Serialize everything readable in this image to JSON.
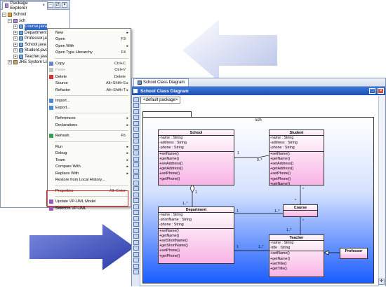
{
  "explorer": {
    "tab_label": "Package Explorer",
    "close_glyph": "×",
    "tree": [
      {
        "label": "School",
        "level": 0,
        "icon": "project-icon",
        "expanded": true
      },
      {
        "label": "sch",
        "level": 1,
        "icon": "package-icon",
        "expanded": true
      },
      {
        "label": "Course.java",
        "level": 2,
        "icon": "java-file-icon",
        "selected": true
      },
      {
        "label": "Department.java",
        "level": 2,
        "icon": "java-file-icon"
      },
      {
        "label": "Professor.java",
        "level": 2,
        "icon": "java-file-icon"
      },
      {
        "label": "School.java",
        "level": 2,
        "icon": "java-file-icon"
      },
      {
        "label": "Student.java",
        "level": 2,
        "icon": "java-file-icon"
      },
      {
        "label": "Teacher.java",
        "level": 2,
        "icon": "java-file-icon"
      },
      {
        "label": "JRE System Library",
        "level": 1,
        "icon": "library-icon"
      }
    ]
  },
  "context_menu": {
    "groups": [
      [
        {
          "label": "New",
          "submenu": true
        },
        {
          "label": "Open",
          "shortcut": "F3"
        },
        {
          "label": "Open With",
          "submenu": true
        },
        {
          "label": "Open Type Hierarchy",
          "shortcut": "F4"
        }
      ],
      [
        {
          "label": "Copy",
          "shortcut": "Ctrl+C",
          "icon": "copy-icon"
        },
        {
          "label": "Paste",
          "shortcut": "Ctrl+V",
          "disabled": true,
          "icon": "paste-icon"
        },
        {
          "label": "Delete",
          "shortcut": "Delete",
          "icon": "delete-icon"
        },
        {
          "label": "Source",
          "shortcut": "Alt+Shift+S",
          "submenu": true
        },
        {
          "label": "Refactor",
          "shortcut": "Alt+Shift+T",
          "submenu": true
        }
      ],
      [
        {
          "label": "Import...",
          "icon": "import-icon"
        },
        {
          "label": "Export...",
          "icon": "export-icon"
        }
      ],
      [
        {
          "label": "References",
          "submenu": true
        },
        {
          "label": "Declarations",
          "submenu": true
        }
      ],
      [
        {
          "label": "Refresh",
          "shortcut": "F5",
          "icon": "refresh-icon"
        }
      ],
      [
        {
          "label": "Run",
          "submenu": true
        },
        {
          "label": "Debug",
          "submenu": true
        },
        {
          "label": "Team",
          "submenu": true
        },
        {
          "label": "Compare With",
          "submenu": true
        },
        {
          "label": "Replace With",
          "submenu": true
        },
        {
          "label": "Restore from Local History..."
        }
      ],
      [
        {
          "label": "Properties",
          "shortcut": "Alt+Enter"
        }
      ],
      [
        {
          "label": "Update VP-UML Model",
          "icon": "vp-uml-icon"
        },
        {
          "label": "Select in VP-UML",
          "icon": "vp-uml-icon"
        }
      ]
    ],
    "submenu_glyph": "▸"
  },
  "diagram_window": {
    "tab_label": "School Class Diagram",
    "title": "School Class Diagram",
    "breadcrumb": "<default package>",
    "package_name": "sch",
    "classes": {
      "school": {
        "name": "School",
        "attributes": [
          "-name : String",
          "-address : String",
          "-phone : String"
        ],
        "operations": [
          "+setName()",
          "+getName()",
          "+setAddress()",
          "+getAddress()",
          "+setPhone()",
          "+getPhone()"
        ]
      },
      "student": {
        "name": "Student",
        "attributes": [
          "-name : String",
          "-address : String",
          "-phone : String"
        ],
        "operations": [
          "+setName()",
          "+getName()",
          "+setAddress()",
          "+getAddress()",
          "+setPhone()",
          "+getPhone()",
          "+getName()"
        ]
      },
      "department": {
        "name": "Department",
        "attributes": [
          "-name : String",
          "-shortName : String",
          "-phone : String"
        ],
        "operations": [
          "+setName()",
          "+getName()",
          "+setShortName()",
          "+getShortName()",
          "+setPhone()",
          "+getPhone()"
        ]
      },
      "course": {
        "name": "Course",
        "attributes": [],
        "operations": []
      },
      "teacher": {
        "name": "Teacher",
        "attributes": [
          "-name : String",
          "-title : String"
        ],
        "operations": [
          "+setName()",
          "+getName()",
          "+setTitle()",
          "+getTitle()"
        ]
      },
      "professor": {
        "name": "Professor",
        "attributes": [],
        "operations": []
      }
    },
    "multiplicities": {
      "school_student_school": "1",
      "school_student_student": "0..*",
      "school_dept_school": "1",
      "school_dept_dept": "1..*",
      "student_course_student": "*",
      "student_course_course": "*",
      "dept_course_dept": "1",
      "dept_course_course": "1..*",
      "course_teacher_course": "*",
      "course_teacher_teacher": "1..*",
      "dept_teacher_dept": "1",
      "dept_teacher_teacher": "1..*"
    }
  },
  "colors": {
    "arrow_light": "#dfe4f6",
    "arrow_dark": "#3d4fb6",
    "title_bar": "#2a62c8",
    "class_fill": "#f8b4e6",
    "package_gradient_end": "#1a5cff",
    "highlight_box": "#d82020"
  }
}
